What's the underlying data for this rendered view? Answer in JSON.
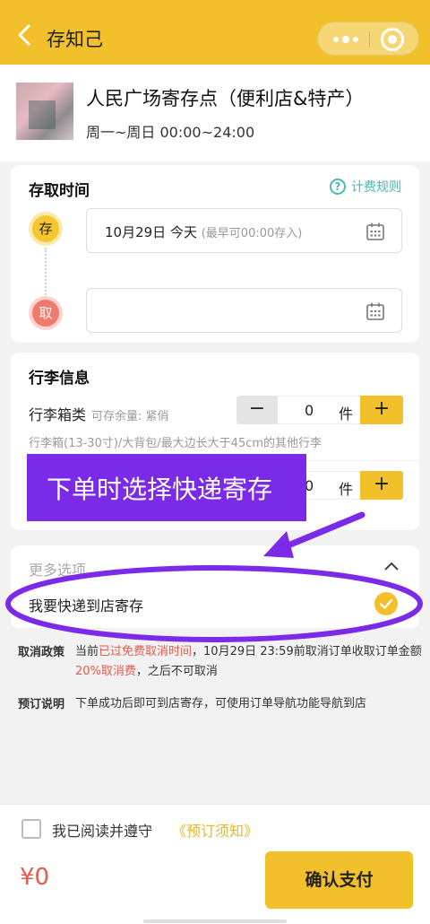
{
  "nav": {
    "title": "存知己"
  },
  "store": {
    "name": "人民广场寄存点（便利店&特产）",
    "hours": "周一~周日 00:00~24:00"
  },
  "time_section": {
    "title": "存取时间",
    "rule_link": "计费规则",
    "store_dot": "存",
    "take_dot": "取",
    "store_date": "10月29日 今天",
    "store_hint": "(最早可00:00存入)",
    "take_value": ""
  },
  "luggage_section": {
    "title": "行李信息",
    "row1_label": "行李箱类",
    "row1_remain": "可存余量: 紧俏",
    "row1_qty": "0",
    "unit": "件",
    "row1_desc": "行李箱(13-30寸)/大背包/最大边长大于45cm的其他行李",
    "row2_qty": "0"
  },
  "annotation": {
    "text": "下单时选择快递寄存"
  },
  "more_section": {
    "title": "更多选项",
    "express_label": "我要快递到店寄存"
  },
  "policy": {
    "cancel_label": "取消政策",
    "cancel_p1": "当前",
    "cancel_p2": "已过免费取消时间",
    "cancel_p3": "，10月29日 23:59前取消订单收取订单金额",
    "cancel_p4": "20%取消费",
    "cancel_p5": "，之后不可取消",
    "booking_label": "预订说明",
    "booking_text": "下单成功后即可到店寄存，可使用订单导航功能导航到店"
  },
  "footer": {
    "agree_text": "我已阅读并遵守",
    "agree_link": "《预订须知》",
    "price": "¥0",
    "pay_label": "确认支付"
  },
  "colors": {
    "accent": "#f2c02a",
    "annotation": "#7b2be8",
    "danger": "#e55a4a",
    "link": "#4ab9b0"
  },
  "icons": [
    "back-icon",
    "more-icon",
    "close-icon",
    "question-icon",
    "calendar-icon",
    "chevron-up-icon",
    "check-icon"
  ]
}
